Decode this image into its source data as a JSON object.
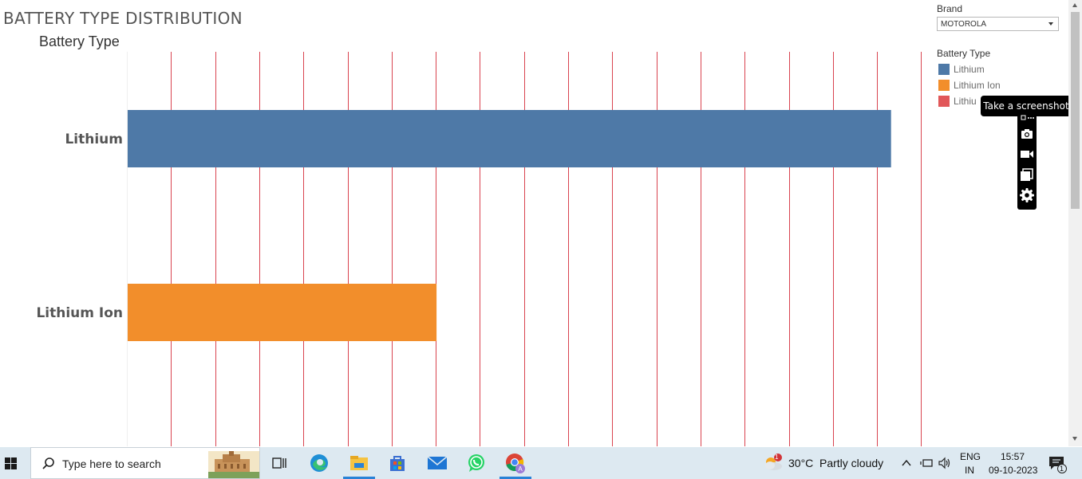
{
  "page": {
    "title": "BATTERY TYPE DISTRIBUTION",
    "axis_header": "Battery Type"
  },
  "filter": {
    "label": "Brand",
    "selected": "MOTOROLA"
  },
  "legend": {
    "title": "Battery Type",
    "items": [
      {
        "label": "Lithium",
        "color": "#4e79a7"
      },
      {
        "label": "Lithium Ion",
        "color": "#f28e2b"
      },
      {
        "label": "Lithiu",
        "color": "#e15759"
      }
    ]
  },
  "tooltip": {
    "text": "Take a screenshot"
  },
  "chart_data": {
    "type": "bar",
    "orientation": "horizontal",
    "categories": [
      "Lithium",
      "Lithium Ion"
    ],
    "values": [
      17.3,
      7.0
    ],
    "colors": [
      "#4e79a7",
      "#f28e2b"
    ],
    "xlim": [
      0,
      18
    ],
    "grid": true,
    "grid_color": "#d9434f",
    "legend_placement": "right"
  },
  "taskbar": {
    "search_placeholder": "Type here to search",
    "weather_temp": "30°C",
    "weather_desc": "Partly cloudy",
    "weather_badge": "1",
    "lang_top": "ENG",
    "lang_bottom": "IN",
    "time": "15:57",
    "date": "09-10-2023",
    "notification_count": "1",
    "icons": [
      "windows-start-icon",
      "search-icon",
      "task-view-icon",
      "edge-icon",
      "file-explorer-icon",
      "store-icon",
      "mail-icon",
      "whatsapp-icon",
      "chrome-icon"
    ]
  }
}
